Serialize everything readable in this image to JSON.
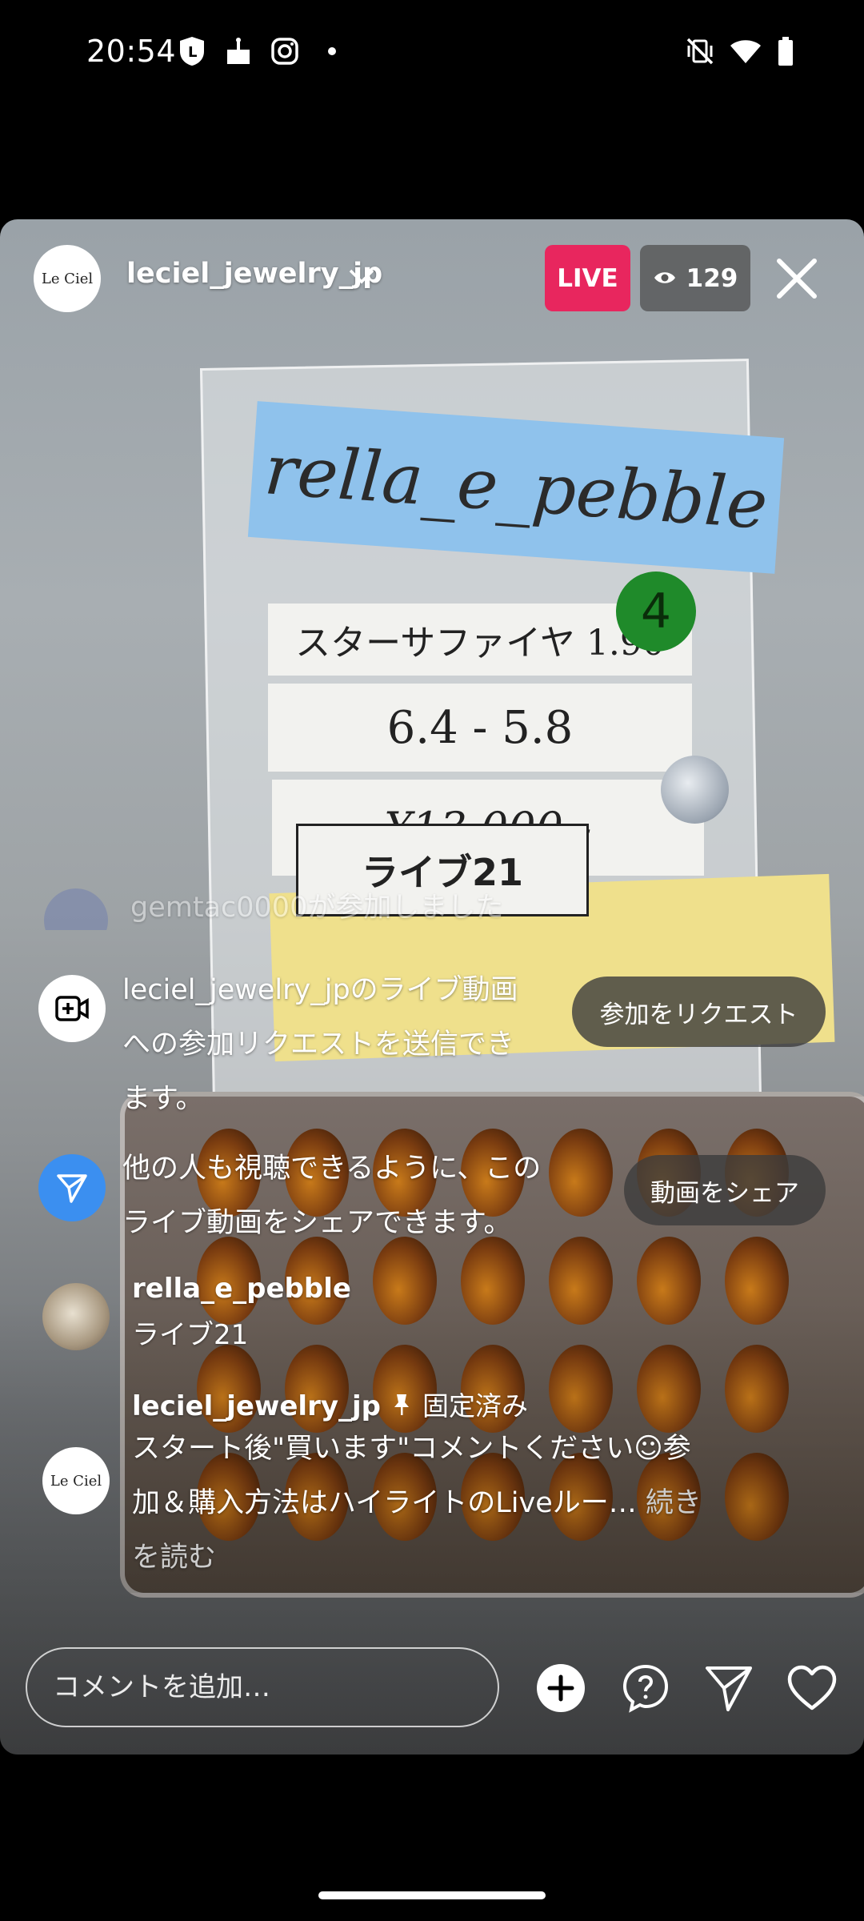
{
  "status_bar": {
    "time": "20:54",
    "icons": [
      "lock-l-icon",
      "cake-icon",
      "instagram-icon",
      "dot-icon",
      "vibrate-off-icon",
      "wifi-icon",
      "battery-icon"
    ]
  },
  "header": {
    "host_avatar_text": "Le Ciel",
    "username": "leciel_jewelry_jp",
    "live_label": "LIVE",
    "viewer_count": "129"
  },
  "scene": {
    "blue_note": "rella_e_pebble",
    "line1": "スターサファイヤ 1.90",
    "badge_number": "4",
    "line2": "6.4 - 5.8",
    "line3": "¥13,000 -",
    "label": "ライブ21"
  },
  "messages": {
    "joined_text": "gemtac0000が参加しました",
    "request": {
      "lines": [
        "leciel_jewelry_jpのライブ動画",
        "への参加リクエストを送信でき",
        "ます。"
      ],
      "button": "参加をリクエスト"
    },
    "share": {
      "lines": [
        "他の人も視聴できるように、この",
        "ライブ動画をシェアできます。"
      ],
      "button": "動画をシェア"
    },
    "comment1": {
      "user": "rella_e_pebble",
      "text": "ライブ21"
    },
    "pinned": {
      "user": "leciel_jewelry_jp",
      "pinned_label": "固定済み",
      "avatar_text": "Le Ciel",
      "line1": "スタート後\"買います\"コメントください☺参",
      "line2": "加＆購入方法はハイライトのLiveルー…",
      "more": "続き",
      "line3": "を読む"
    }
  },
  "bottom_bar": {
    "comment_placeholder": "コメントを追加…"
  },
  "colors": {
    "live_red": "#e8265e",
    "share_blue": "#3b8ff0"
  }
}
